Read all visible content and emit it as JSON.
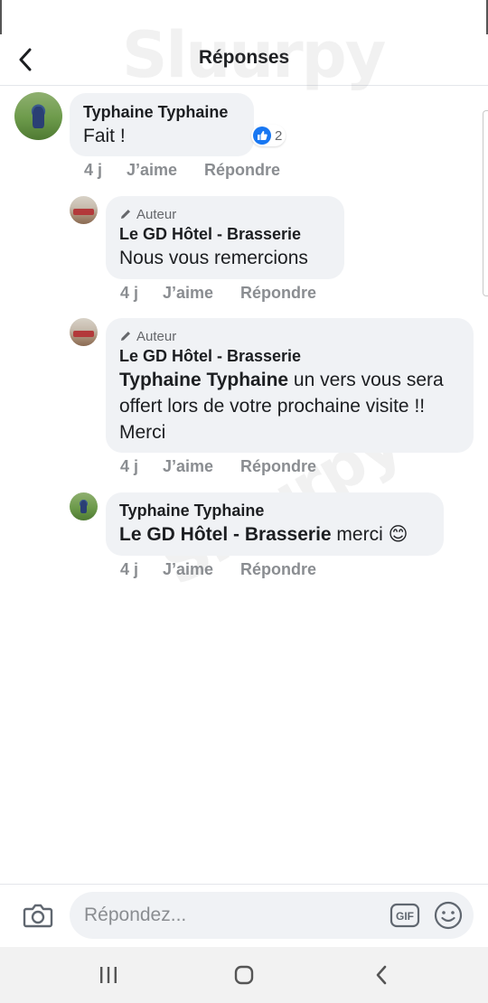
{
  "header": {
    "title": "Réponses"
  },
  "comments": [
    {
      "author": "Typhaine Typhaine",
      "text": "Fait !",
      "reactions_count": "2",
      "time": "4 j",
      "like_label": "J’aime",
      "reply_label": "Répondre"
    },
    {
      "badge": "Auteur",
      "author": "Le GD Hôtel - Brasserie",
      "text": "Nous vous remercions",
      "time": "4 j",
      "like_label": "J’aime",
      "reply_label": "Répondre"
    },
    {
      "badge": "Auteur",
      "author": "Le GD Hôtel - Brasserie",
      "mention": "Typhaine Typhaine",
      "text": " un vers vous sera offert lors de votre prochaine visite !! Merci",
      "time": "4 j",
      "like_label": "J’aime",
      "reply_label": "Répondre"
    },
    {
      "author": "Typhaine Typhaine",
      "mention": "Le GD Hôtel - Brasserie",
      "text": " merci",
      "emoji": "😊",
      "time": "4 j",
      "like_label": "J’aime",
      "reply_label": "Répondre"
    }
  ],
  "composer": {
    "placeholder": "Répondez...",
    "gif_label": "GIF"
  },
  "watermark": {
    "text": "Sluurpy"
  },
  "icons": {
    "back": "chevron-left-icon",
    "author_badge": "pencil-icon",
    "reaction": "like-icon",
    "camera": "camera-icon",
    "gif": "gif-icon",
    "emoji": "smiley-icon",
    "nav_recents": "recents-icon",
    "nav_home": "home-icon",
    "nav_back": "back-icon"
  },
  "colors": {
    "bubble": "#f0f2f5",
    "like_blue": "#1877f2",
    "meta_gray": "#8a8d91"
  }
}
